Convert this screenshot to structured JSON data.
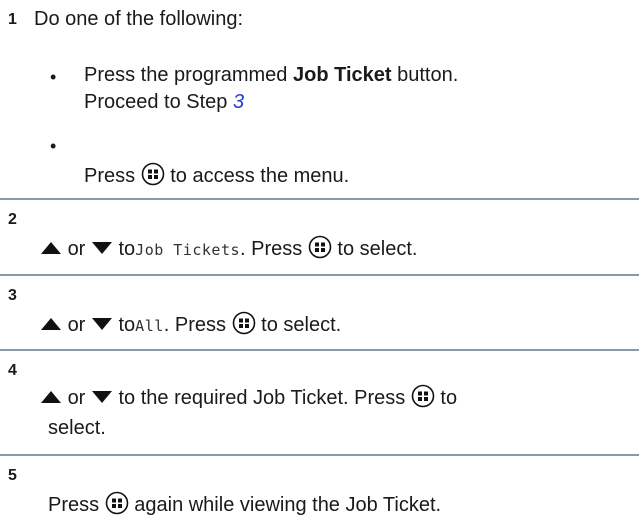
{
  "step1": {
    "number": "1",
    "intro": "Do one of the following:",
    "opt1_press": "Press the programmed",
    "opt1_bold": "Job Ticket",
    "opt1_after": "button.",
    "opt1_proceed": "Proceed to Step",
    "opt1_link": "3",
    "opt2_press": "Press",
    "opt2_after": "to access the menu."
  },
  "step2": {
    "number": "2",
    "or": "or",
    "to": "to",
    "lcd": "Job Tickets",
    "press": ". Press",
    "after": "to select."
  },
  "step3": {
    "number": "3",
    "or": "or",
    "to": "to",
    "lcd": "All",
    "press": ". Press",
    "after": "to select."
  },
  "step4": {
    "number": "4",
    "or": "or",
    "text": "to the required Job Ticket. Press",
    "after": "to",
    "line2": "select."
  },
  "step5": {
    "number": "5",
    "press": "Press",
    "after": "again while viewing the Job Ticket."
  },
  "icons": {
    "menu": "menu-ok-button-icon",
    "up": "up-arrow-icon",
    "down": "down-arrow-icon"
  }
}
